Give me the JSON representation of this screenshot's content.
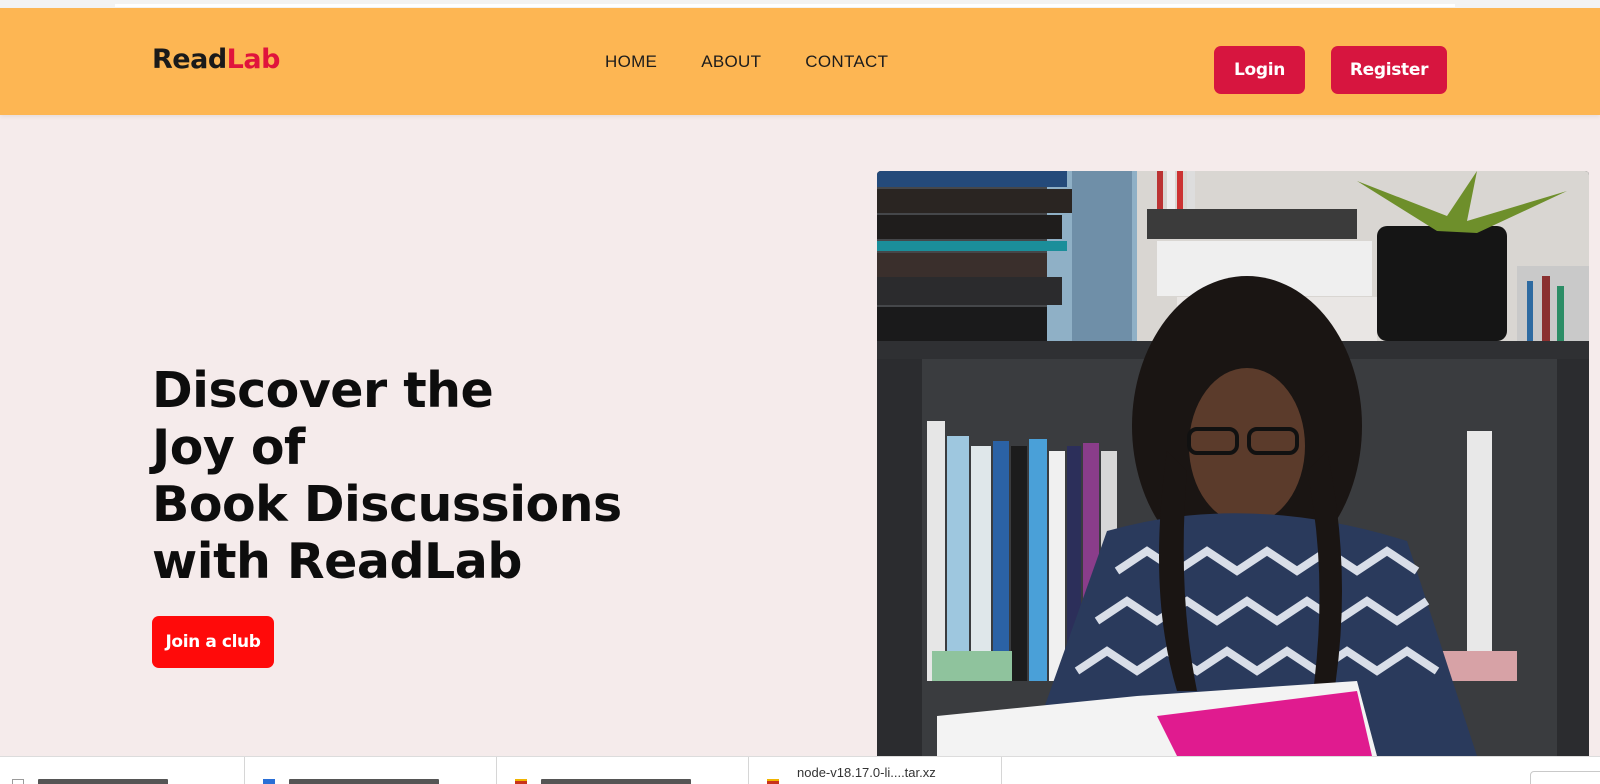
{
  "brand": {
    "part1": "Read",
    "part2": "Lab",
    "color_dark": "#1a1a1a",
    "color_accent": "#e0143c"
  },
  "nav": {
    "items": [
      "HOME",
      "ABOUT",
      "CONTACT"
    ]
  },
  "auth": {
    "login_label": "Login",
    "register_label": "Register",
    "color": "#d7153f"
  },
  "hero": {
    "title_lines": [
      "Discover the",
      "Joy of",
      "Book Discussions",
      "with ReadLab"
    ],
    "cta_label": "Join a club",
    "cta_color": "#ff0a0a"
  },
  "image": {
    "description_icon": "woman-reading-photo"
  },
  "colors": {
    "navbar": "#fdb653",
    "page": "#f5ebeb"
  },
  "downloads_bar": {
    "items": [
      {
        "name": "node-v18.17.0-li....tar.xz",
        "icon": "archive-icon"
      }
    ]
  }
}
